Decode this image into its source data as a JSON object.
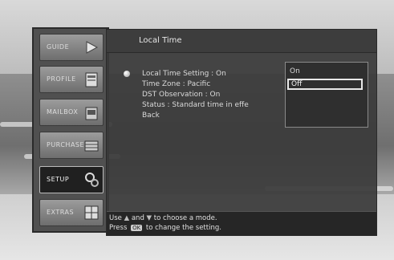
{
  "tabs": [
    {
      "label": "GUIDE",
      "icon": "arrow-right-icon"
    },
    {
      "label": "PROFILE",
      "icon": "profile-card-icon"
    },
    {
      "label": "MAILBOX",
      "icon": "mailbox-icon"
    },
    {
      "label": "PURCHASES",
      "icon": "purchase-icon"
    },
    {
      "label": "SETUP",
      "icon": "setup-gear-icon",
      "active": true
    },
    {
      "label": "EXTRAS",
      "icon": "extras-grid-icon"
    }
  ],
  "panel": {
    "title": "Local Time",
    "menu": [
      "Local Time Setting : On",
      "Time Zone : Pacific",
      "DST Observation : On",
      "Status : Standard time in effe",
      "Back"
    ]
  },
  "dropdown": {
    "options": [
      "On",
      "Off"
    ],
    "selected": "Off"
  },
  "help": {
    "line1_a": "Use",
    "line1_b": "and",
    "line1_c": "to choose a mode.",
    "line2_a": "Press",
    "ok_key": "OK",
    "line2_b": "to change the setting."
  },
  "colors": {
    "panel_bg": "#3a3a3a",
    "active_tab": "#202020",
    "selection_outline": "#e8e8e8"
  }
}
